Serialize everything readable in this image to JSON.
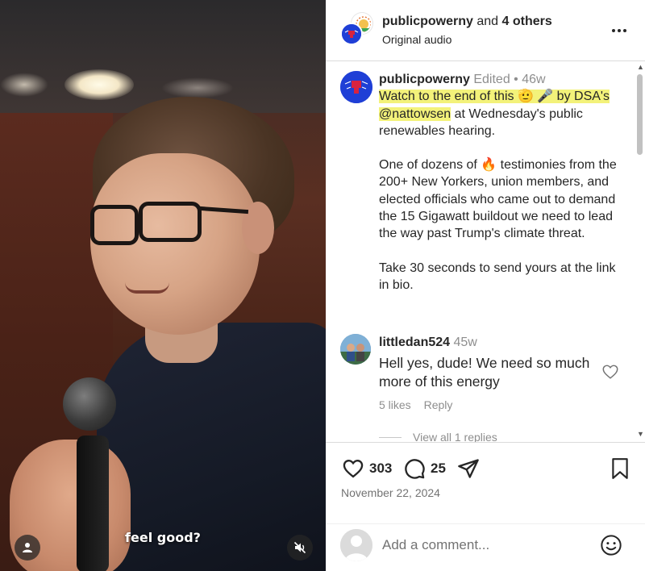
{
  "video": {
    "caption_text": "feel good?"
  },
  "header": {
    "username": "publicpowerny",
    "and_text": " and ",
    "others": "4 others",
    "audio": "Original audio"
  },
  "post": {
    "username": "publicpowerny",
    "edited": "Edited",
    "separator": " • ",
    "age": "46w",
    "line1_highlight": "Watch to the end of this 🫡 🎤 by DSA's",
    "mention": "@nattowsen",
    "line2": " at Wednesday's public renewables hearing.",
    "para2": "One of dozens of 🔥 testimonies from the 200+ New Yorkers, union members, and elected officials who came out to demand the 15 Gigawatt buildout we need to lead the way past Trump's climate threat.",
    "para3": "Take 30 seconds to send yours at the link in bio."
  },
  "comment": {
    "username": "littledan524",
    "age": "45w",
    "text": "Hell yes, dude! We need so much more of this energy",
    "likes": "5 likes",
    "reply_label": "Reply",
    "view_replies": "View all 1 replies"
  },
  "actions": {
    "likes": "303",
    "comments": "25",
    "date": "November 22, 2024"
  },
  "composer": {
    "placeholder": "Add a comment..."
  },
  "colors": {
    "brand_blue": "#1f3fd6",
    "highlight": "#f3f27a",
    "muted_text": "#8e8e8e"
  }
}
